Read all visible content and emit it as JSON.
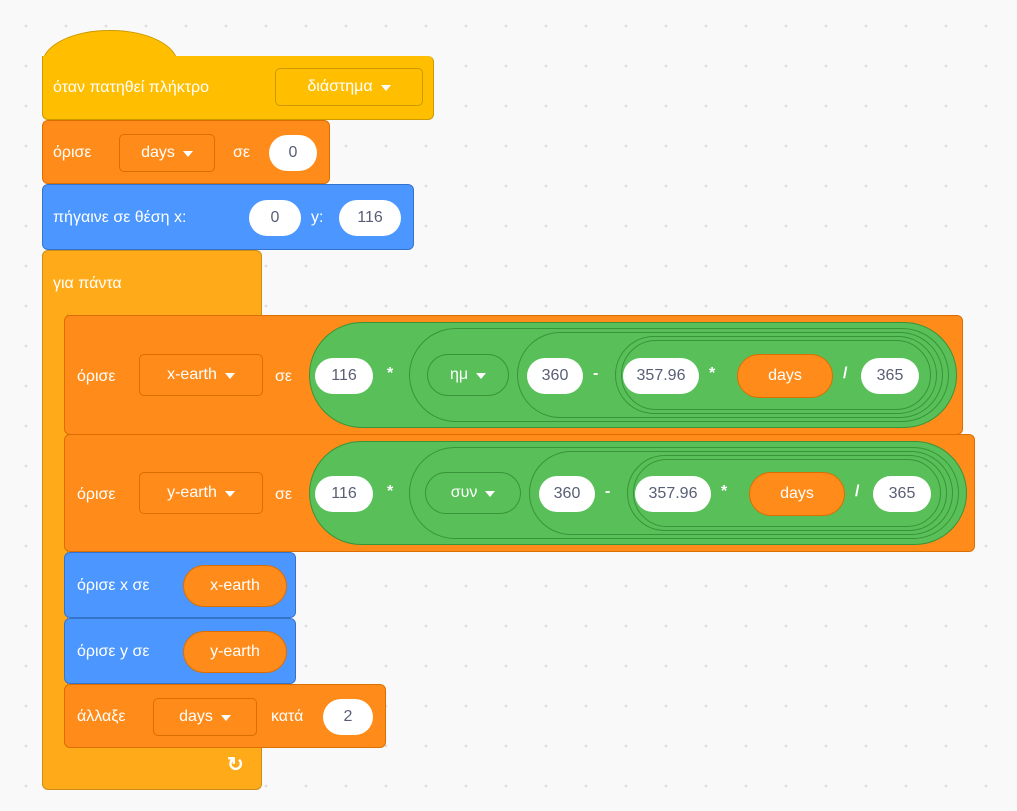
{
  "hat": {
    "label": "όταν πατηθεί πλήκτρο",
    "key": "διάστημα"
  },
  "set_days": {
    "label": "όρισε",
    "var": "days",
    "to": "σε",
    "value": "0"
  },
  "goto": {
    "label": "πήγαινε σε θέση x:",
    "x": "0",
    "ylabel": "y:",
    "y": "116"
  },
  "forever": {
    "label": "για πάντα",
    "loop_icon": "↻"
  },
  "set_xearth": {
    "label": "όρισε",
    "var": "x-earth",
    "to": "σε",
    "mult_left": "116",
    "op1": "*",
    "func": "ημ",
    "a": "360",
    "minus": "-",
    "b": "357.96",
    "op2": "*",
    "reporter": "days",
    "div": "/",
    "c": "365"
  },
  "set_yearth": {
    "label": "όρισε",
    "var": "y-earth",
    "to": "σε",
    "mult_left": "116",
    "op1": "*",
    "func": "συν",
    "a": "360",
    "minus": "-",
    "b": "357.96",
    "op2": "*",
    "reporter": "days",
    "div": "/",
    "c": "365"
  },
  "set_x": {
    "label": "όρισε x σε",
    "reporter": "x-earth"
  },
  "set_y": {
    "label": "όρισε y σε",
    "reporter": "y-earth"
  },
  "change_days": {
    "label": "άλλαξε",
    "var": "days",
    "by": "κατά",
    "value": "2"
  },
  "colors": {
    "events": "#ffbf00",
    "variables": "#ff8c1a",
    "motion": "#4c97ff",
    "control": "#ffab19",
    "operators": "#59c059"
  }
}
